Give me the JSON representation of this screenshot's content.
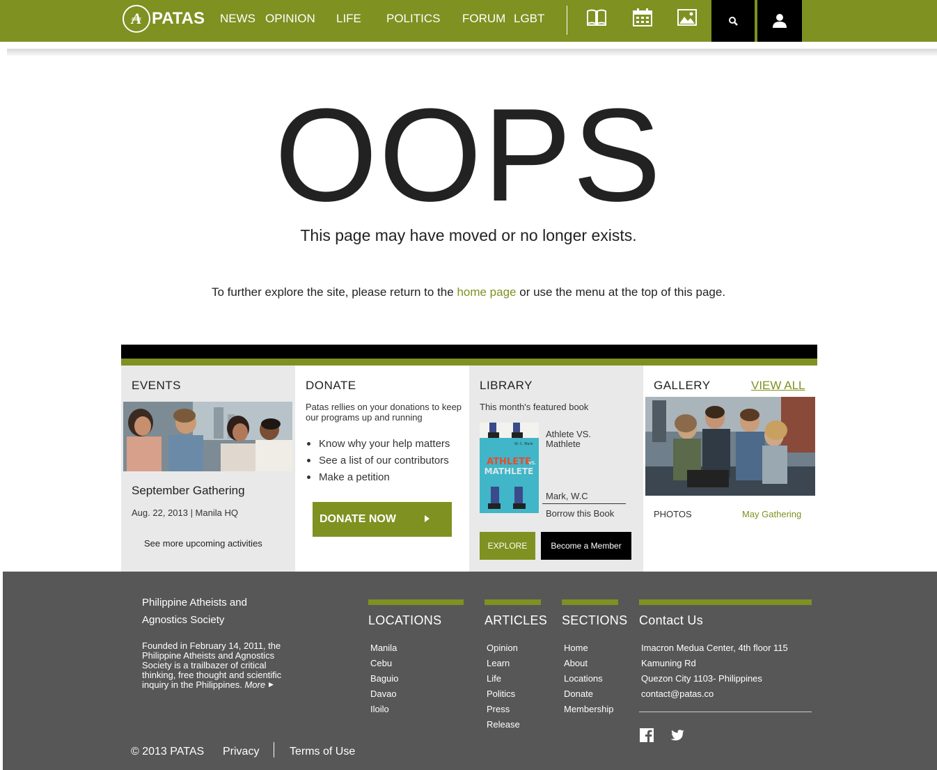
{
  "nav": {
    "logo_text": "PATAS",
    "logo_glyph": "₳",
    "items": [
      "NEWS",
      "OPINION",
      "LIFE",
      "POLITICS",
      "FORUM",
      "LGBT"
    ],
    "icons": [
      "book-icon",
      "calendar-icon",
      "image-icon",
      "search-icon",
      "user-icon"
    ],
    "accent_color": "#7f9121"
  },
  "error": {
    "headline": "OOPS",
    "subtitle": "This page may have moved or no longer exists.",
    "explore_before": "To further explore the site, please return to the ",
    "home_link": "home page",
    "explore_after": " or use the menu at the top of this page."
  },
  "events": {
    "title": "EVENTS",
    "event_name": "September Gathering",
    "event_date": "Aug. 22, 2013 | Manila HQ",
    "more_link": "See more upcoming activities"
  },
  "donate": {
    "title": "DONATE",
    "description": "Patas rellies on your donations to keep our programs up and running",
    "links": [
      "Know why your help matters",
      "See a list of our contributors",
      "Make a petition"
    ],
    "button": "DONATE NOW"
  },
  "library": {
    "title": "LIBRARY",
    "subtitle": "This month's featured book",
    "book_title": "Athlete VS. Mathlete",
    "book_author": "Mark, W.C",
    "borrow": "Borrow this Book",
    "cover_title_1": "ATHLETE",
    "cover_title_vs": "vs.",
    "cover_title_2": "MATHLETE",
    "cover_author": "W. C. Mark",
    "explore_button": "EXPLORE",
    "member_button": "Become a Member"
  },
  "gallery": {
    "title": "GALLERY",
    "view_all": "VIEW ALL",
    "photos_label": "PHOTOS",
    "caption": "May Gathering"
  },
  "footer": {
    "org_name": "Philippine Atheists and Agnostics Society",
    "org_desc": "Founded in February 14, 2011, the Philippine Atheists and Agnostics Society is a trailbazer of critical thinking, free thought and scientific inquiry in the Philippines.",
    "more": "More",
    "locations": {
      "title": "LOCATIONS",
      "items": [
        "Manila",
        "Cebu",
        "Baguio",
        "Davao",
        "Iloilo"
      ]
    },
    "articles": {
      "title": "ARTICLES",
      "items": [
        "Opinion",
        "Learn",
        "Life",
        "Politics",
        "Press",
        "Release"
      ]
    },
    "sections": {
      "title": "SECTIONS",
      "items": [
        "Home",
        "About",
        "Locations",
        "Donate",
        "Membership"
      ]
    },
    "contact": {
      "title": "Contact Us",
      "lines": [
        "Imacron Medua Center, 4th floor 115",
        "Kamuning Rd",
        "Quezon City 1103- Philippines",
        "contact@patas.co"
      ]
    },
    "social": [
      "facebook-icon",
      "twitter-icon"
    ],
    "copyright": "© 2013 PATAS",
    "privacy": "Privacy",
    "terms": "Terms of Use"
  }
}
